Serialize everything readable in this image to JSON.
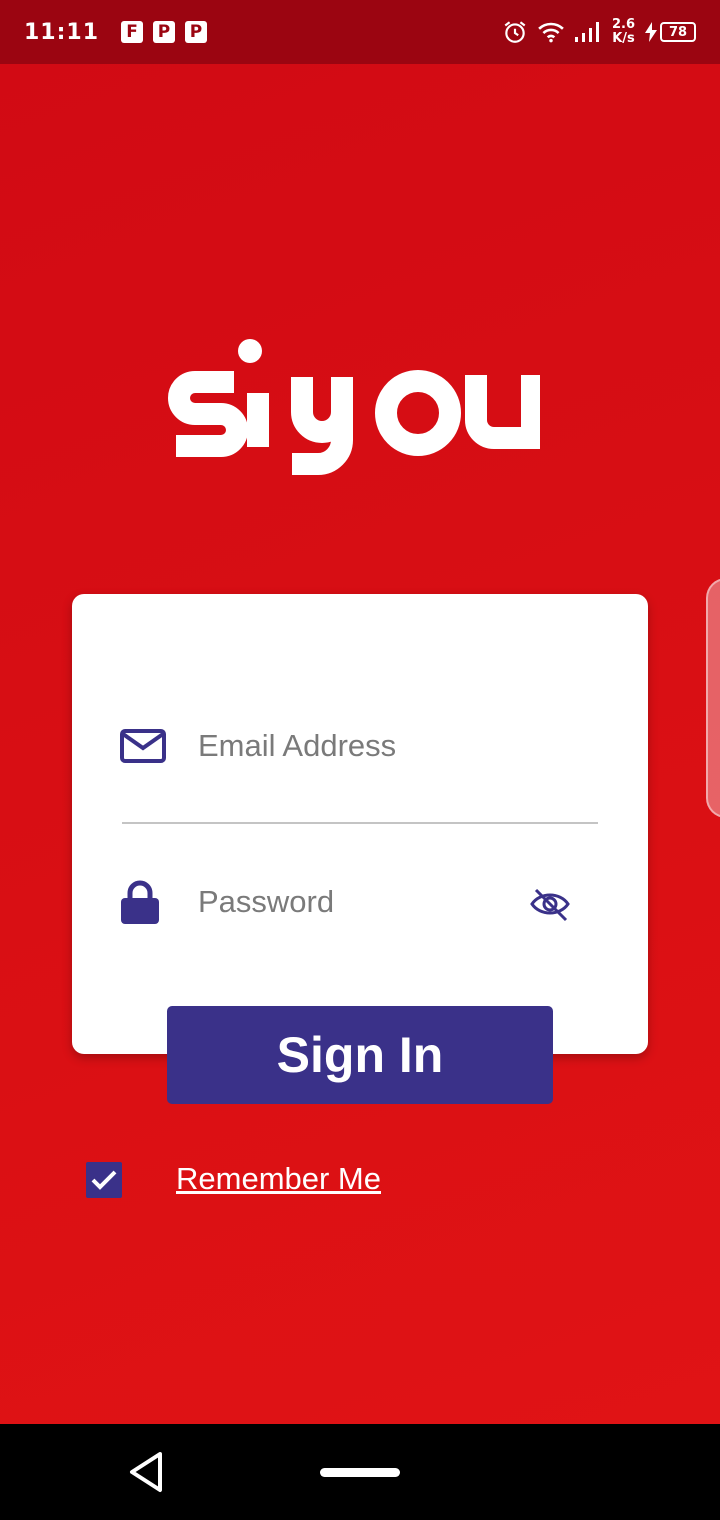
{
  "status_bar": {
    "time": "11:11",
    "apps": [
      "F",
      "P",
      "P"
    ],
    "speed_value": "2.6",
    "speed_unit": "K/s",
    "battery": "78"
  },
  "logo": {
    "text": "siyou"
  },
  "login": {
    "email_placeholder": "Email Address",
    "password_placeholder": "Password",
    "sign_in_label": "Sign In",
    "remember_label": "Remember Me",
    "remember_checked": true
  },
  "colors": {
    "background": "#d80f15",
    "status_bar": "#9b0511",
    "accent": "#3a3189",
    "card": "#ffffff"
  }
}
